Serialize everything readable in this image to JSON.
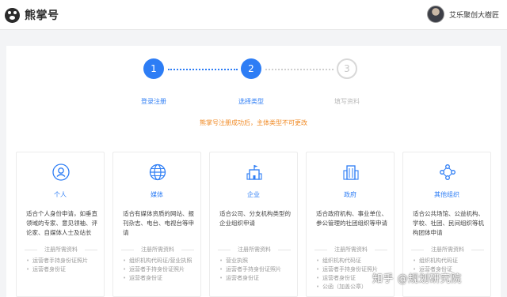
{
  "brand": {
    "name": "熊掌号"
  },
  "user": {
    "name": "艾乐聚创大樹匠"
  },
  "steps": [
    {
      "number": "1",
      "label": "登录注册"
    },
    {
      "number": "2",
      "label": "选择类型"
    },
    {
      "number": "3",
      "label": "填写资料"
    }
  ],
  "notice": "熊掌号注册成功后，主体类型不可更改",
  "types": [
    {
      "name": "个人",
      "icon": "person-icon",
      "desc": "适合个人身份申请，如垂直领域的专家、意见领袖、评论家、自媒体人士及站长",
      "req_title": "注册所需资料",
      "reqs": [
        "运营者手持身份证照片",
        "运营者身份证"
      ]
    },
    {
      "name": "媒体",
      "icon": "globe-icon",
      "desc": "适合有媒体资质的网站、报刊杂志、电台、电视台等申请",
      "req_title": "注册所需资料",
      "reqs": [
        "组织机构代码证/营业执照",
        "运营者手持身份证照片",
        "运营者身份证"
      ]
    },
    {
      "name": "企业",
      "icon": "building-flag-icon",
      "desc": "适合公司、分支机构类型的企业组织申请",
      "req_title": "注册所需资料",
      "reqs": [
        "营业执照",
        "运营者手持身份证照片",
        "运营者身份证"
      ]
    },
    {
      "name": "政府",
      "icon": "government-building-icon",
      "desc": "适合政府机构、事业单位、参公管理的社团组织等申请",
      "req_title": "注册所需资料",
      "reqs": [
        "组织机构代码证",
        "运营者手持身份证照片",
        "运营者身份证",
        "公函（加盖公章）"
      ]
    },
    {
      "name": "其他组织",
      "icon": "network-icon",
      "desc": "适合公共场馆、公益机构、学校、社团、民间组织等机构团体申请",
      "req_title": "注册所需资料",
      "reqs": [
        "组织机构代码证",
        "运营者身份证"
      ]
    }
  ],
  "watermark": "知乎 @规划研究院",
  "colors": {
    "accent": "#2d7df5",
    "notice": "#f08a24"
  }
}
